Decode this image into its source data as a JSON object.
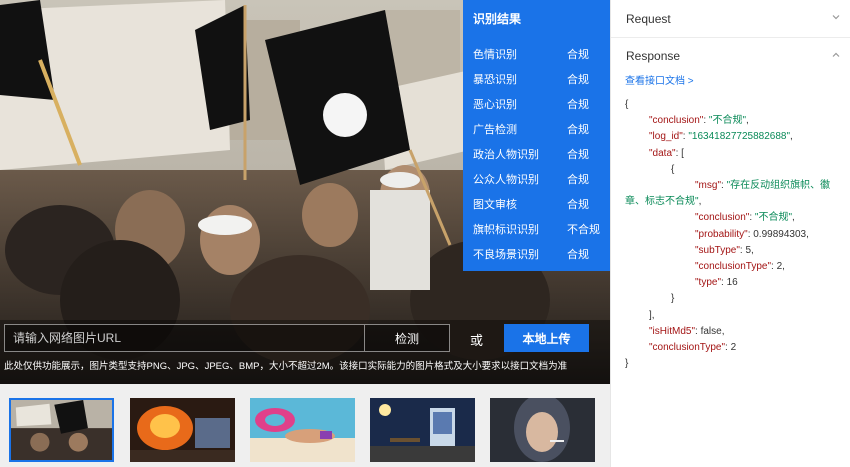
{
  "result_panel": {
    "title": "识别结果",
    "rows": [
      {
        "name": "色情识别",
        "value": "合规"
      },
      {
        "name": "暴恐识别",
        "value": "合规"
      },
      {
        "name": "恶心识别",
        "value": "合规"
      },
      {
        "name": "广告检测",
        "value": "合规"
      },
      {
        "name": "政治人物识别",
        "value": "合规"
      },
      {
        "name": "公众人物识别",
        "value": "合规"
      },
      {
        "name": "图文审核",
        "value": "合规"
      },
      {
        "name": "旗帜标识识别",
        "value": "不合规"
      },
      {
        "name": "不良场景识别",
        "value": "合规"
      }
    ]
  },
  "url_bar": {
    "placeholder": "请输入网络图片URL",
    "detect_label": "检测",
    "or_label": "或",
    "upload_label": "本地上传"
  },
  "notice": "此处仅供功能展示，图片类型支持PNG、JPG、JPEG、BMP，大小不超过2M。该接口实际能力的图片格式及大小要求以接口文档为准",
  "thumbnails": {
    "active_index": 0,
    "items": [
      "thumb-1",
      "thumb-2",
      "thumb-3",
      "thumb-4",
      "thumb-5"
    ]
  },
  "side": {
    "request_label": "Request",
    "response_label": "Response",
    "api_link": "查看接口文档 >"
  },
  "json": {
    "open_brace": "{",
    "conclusion_key": "\"conclusion\"",
    "conclusion_val": "\"不合规\"",
    "log_id_key": "\"log_id\"",
    "log_id_val": "\"16341827725882688\"",
    "data_key": "\"data\"",
    "data_open": "[",
    "item_open": "{",
    "msg_key": "\"msg\"",
    "msg_val": "\"存在反动组织旗帜、徽章、标志不合规\"",
    "inner_conclusion_key": "\"conclusion\"",
    "inner_conclusion_val": "\"不合规\"",
    "probability_key": "\"probability\"",
    "probability_val": "0.99894303",
    "subtype_key": "\"subType\"",
    "subtype_val": "5",
    "conclusion_type_key": "\"conclusionType\"",
    "conclusion_type_val": "2",
    "type_key": "\"type\"",
    "type_val": "16",
    "item_close": "}",
    "data_close": "],",
    "ishit_key": "\"isHitMd5\"",
    "ishit_val": "false",
    "outer_conclusion_type_key": "\"conclusionType\"",
    "outer_conclusion_type_val": "2",
    "close_brace": "}"
  },
  "colors": {
    "accent": "#1a73e8",
    "json_key": "#a31515",
    "json_string": "#0a8a58"
  }
}
